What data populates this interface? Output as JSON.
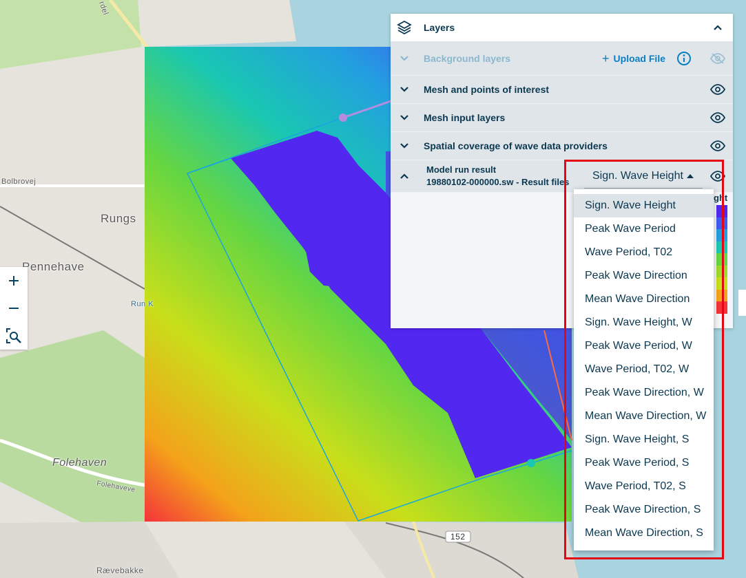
{
  "map": {
    "labels": [
      "Bolbrovej",
      "Rungs",
      "Pennehave",
      "Run K",
      "Folehaven",
      "Folehaveve",
      "152",
      "Rævebakke",
      "rdel"
    ]
  },
  "zoom": {
    "in_icon": "plus-icon",
    "out_icon": "minus-icon",
    "extent_icon": "zoom-to-extent-icon"
  },
  "layers_panel": {
    "title": "Layers",
    "rows": [
      {
        "title": "Background layers",
        "upload_label": "Upload File"
      },
      {
        "title": "Mesh and points of interest"
      },
      {
        "title": "Mesh input layers"
      },
      {
        "title": "Spatial coverage of wave data providers"
      }
    ],
    "model_run": {
      "title": "Model run result",
      "subtitle": "19880102-000000.sw - Result files",
      "selected": "Sign. Wave Height",
      "legend_partial_label": "ght"
    }
  },
  "dropdown_options": [
    "Sign. Wave Height",
    "Peak Wave Period",
    "Wave Period, T02",
    "Peak Wave Direction",
    "Mean Wave Direction",
    "Sign. Wave Height, W",
    "Peak Wave Period, W",
    "Wave Period, T02, W",
    "Peak Wave Direction, W",
    "Mean Wave Direction, W",
    "Sign. Wave Height, S",
    "Peak Wave Period, S",
    "Wave Period, T02, S",
    "Peak Wave Direction, S",
    "Mean Wave Direction, S"
  ],
  "colors": {
    "accent": "#0b7fc4",
    "highlight": "#e30613",
    "text": "#0b3850"
  }
}
